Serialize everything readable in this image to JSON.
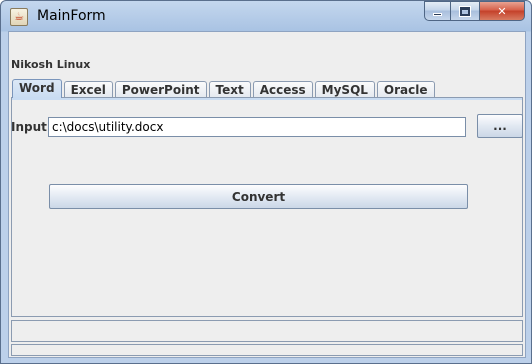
{
  "window": {
    "title": "MainForm",
    "icon": "java-cup-icon",
    "minimize_icon": "minimize-icon",
    "maximize_icon": "maximize-icon",
    "close_icon": "close-icon",
    "close_glyph": "✕"
  },
  "panel": {
    "title": "Nikosh Linux"
  },
  "tabs": [
    {
      "label": "Word",
      "active": true
    },
    {
      "label": "Excel",
      "active": false
    },
    {
      "label": "PowerPoint",
      "active": false
    },
    {
      "label": "Text",
      "active": false
    },
    {
      "label": "Access",
      "active": false
    },
    {
      "label": "MySQL",
      "active": false
    },
    {
      "label": "Oracle",
      "active": false
    }
  ],
  "form": {
    "input_label": "Input",
    "input_value": "c:\\docs\\utility.docx",
    "browse_label": "...",
    "convert_label": "Convert"
  }
}
